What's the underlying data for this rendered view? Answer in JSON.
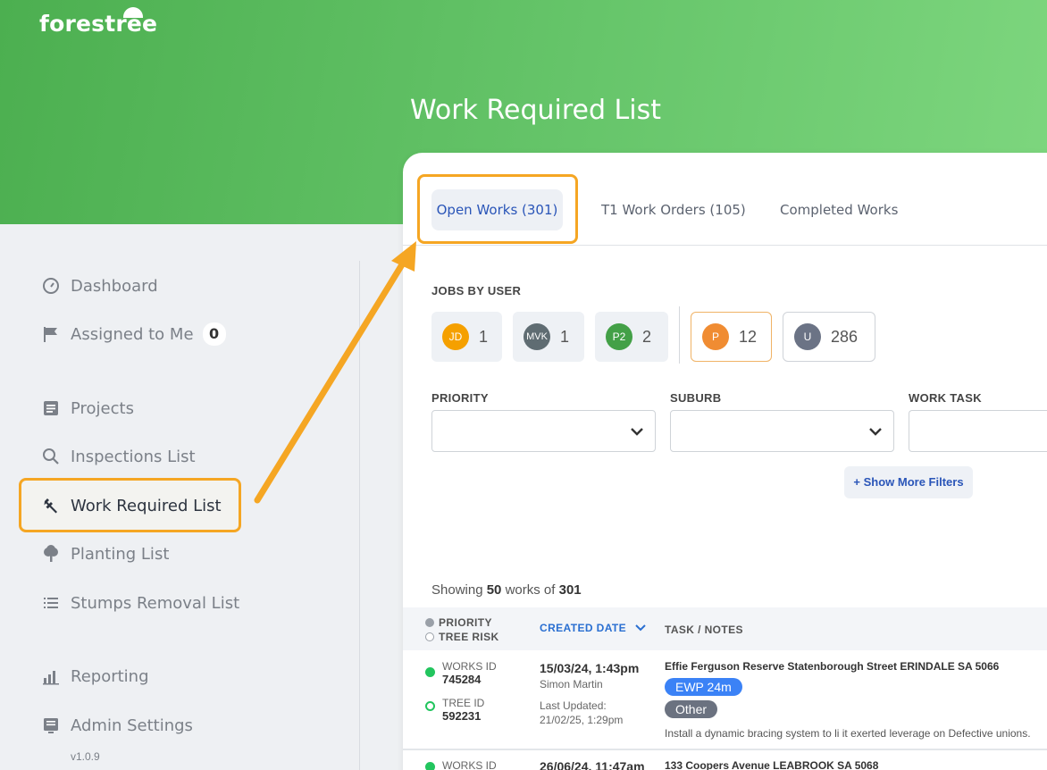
{
  "brand": {
    "logo_text": "forestree"
  },
  "page": {
    "title": "Work Required List"
  },
  "sidebar": {
    "items": [
      {
        "label": "Dashboard",
        "icon": "gauge-icon"
      },
      {
        "label": "Assigned to Me",
        "icon": "flag-icon",
        "badge": "0"
      },
      {
        "label": "Projects",
        "icon": "document-icon"
      },
      {
        "label": "Inspections List",
        "icon": "search-icon"
      },
      {
        "label": "Work Required List",
        "icon": "wrench-icon",
        "active": true
      },
      {
        "label": "Planting List",
        "icon": "tree-icon"
      },
      {
        "label": "Stumps Removal List",
        "icon": "list-icon"
      },
      {
        "label": "Reporting",
        "icon": "bar-chart-icon"
      },
      {
        "label": "Admin Settings",
        "icon": "settings-doc-icon"
      }
    ],
    "version": "v1.0.9"
  },
  "tabs": [
    {
      "label": "Open Works (301)",
      "active": true
    },
    {
      "label": "T1 Work Orders (105)"
    },
    {
      "label": "Completed Works"
    }
  ],
  "jobs_by_user": {
    "label": "JOBS BY USER",
    "users": [
      {
        "initials": "JD",
        "count": "1",
        "color": "#f5a000"
      },
      {
        "initials": "MVK",
        "count": "1",
        "color": "#5f6c72"
      },
      {
        "initials": "P2",
        "count": "2",
        "color": "#43a047"
      },
      {
        "initials": "P",
        "count": "12",
        "color": "#f08c32"
      },
      {
        "initials": "U",
        "count": "286",
        "color": "#6b7385"
      }
    ]
  },
  "filters": {
    "priority_label": "PRIORITY",
    "suburb_label": "SUBURB",
    "work_task_label": "WORK TASK",
    "more_filters": "+ Show More Filters"
  },
  "results": {
    "prefix": "Showing",
    "shown": "50",
    "middle": "works of",
    "total": "301"
  },
  "table": {
    "headers": {
      "priority": "PRIORITY",
      "tree_risk": "TREE RISK",
      "created_date": "CREATED DATE",
      "task_notes": "TASK / NOTES"
    },
    "rows": [
      {
        "works_id_label": "WORKS ID",
        "works_id": "745284",
        "tree_id_label": "TREE ID",
        "tree_id": "592231",
        "created": "15/03/24, 1:43pm",
        "created_by": "Simon Martin",
        "updated_label": "Last Updated:",
        "updated": "21/02/25, 1:29pm",
        "address": "Effie Ferguson Reserve Statenborough Street ERINDALE SA 5066",
        "tags": [
          "EWP 24m",
          "Other"
        ],
        "note": "Install a dynamic bracing system to li it exerted leverage on Defective unions."
      },
      {
        "works_id_label": "WORKS ID",
        "created": "26/06/24, 11:47am",
        "address": "133 Coopers Avenue LEABROOK SA 5068"
      }
    ]
  },
  "colors": {
    "accent": "#2a55b8",
    "highlight": "#f5a623",
    "hero": "#5bbd5e",
    "priority_dot": "#22c55e"
  }
}
